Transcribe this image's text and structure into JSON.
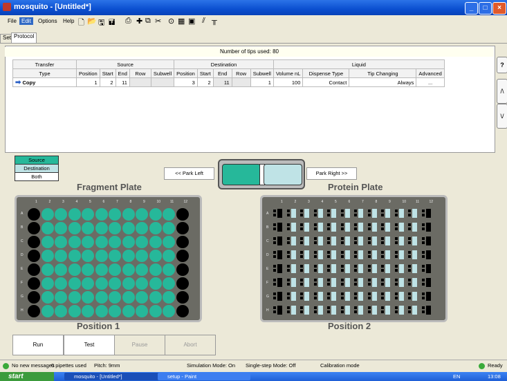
{
  "window": {
    "title": "mosquito - [Untitled*]"
  },
  "menu": [
    "File",
    "Edit",
    "Options",
    "Help"
  ],
  "tabs": [
    "Setup",
    "Protocol"
  ],
  "tips_used": "Number of tips used: 80",
  "table": {
    "group_headers": [
      "Transfer",
      "Source",
      "Destination",
      "Liquid"
    ],
    "columns": [
      "Type",
      "Position",
      "Start",
      "End",
      "Row",
      "Subwell",
      "Position",
      "Start",
      "End",
      "Row",
      "Subwell",
      "Volume nL",
      "Dispense Type",
      "Tip Changing",
      "Advanced"
    ],
    "row": {
      "type": "Copy",
      "src_position": "1",
      "src_start": "2",
      "src_end": "11",
      "src_row": "",
      "src_subwell": "",
      "dst_position": "3",
      "dst_start": "2",
      "dst_end": "11",
      "dst_row": "",
      "dst_subwell": "1",
      "volume": "100",
      "dispense": "Contact",
      "tip_changing": "Always",
      "advanced": "..."
    }
  },
  "side_buttons": [
    "?",
    "/\\",
    "\\/"
  ],
  "legend": [
    "Source",
    "Destination",
    "Both"
  ],
  "park_left": "<< Park Left",
  "park_right": "Park Right >>",
  "fragment_plate": {
    "title": "Fragment Plate",
    "position": "Position 1"
  },
  "protein_plate": {
    "title": "Protein Plate",
    "position": "Position 2"
  },
  "plate_columns": [
    "1",
    "2",
    "3",
    "4",
    "5",
    "6",
    "7",
    "8",
    "9",
    "10",
    "11",
    "12"
  ],
  "plate_rows": [
    "A",
    "B",
    "C",
    "D",
    "E",
    "F",
    "G",
    "H"
  ],
  "controls": [
    "Run",
    "Test",
    "Pause",
    "Abort"
  ],
  "status": {
    "messages": "No new messages",
    "pipettes": "0 pipettes used",
    "pitch": "Pitch: 9mm",
    "simulation": "Simulation Mode: On",
    "singlestep": "Single-step Mode: Off",
    "calibration": "Calibration mode",
    "ready": "Ready"
  },
  "taskbar": {
    "start": "start",
    "task1": "mosquito - [Untitled*]",
    "task2": "setup - Paint",
    "lang": "EN",
    "clock": "13:08"
  },
  "colors": {
    "teal": "#26b89a",
    "light_teal": "#bfe3e6",
    "plate": "#6b6b64"
  }
}
